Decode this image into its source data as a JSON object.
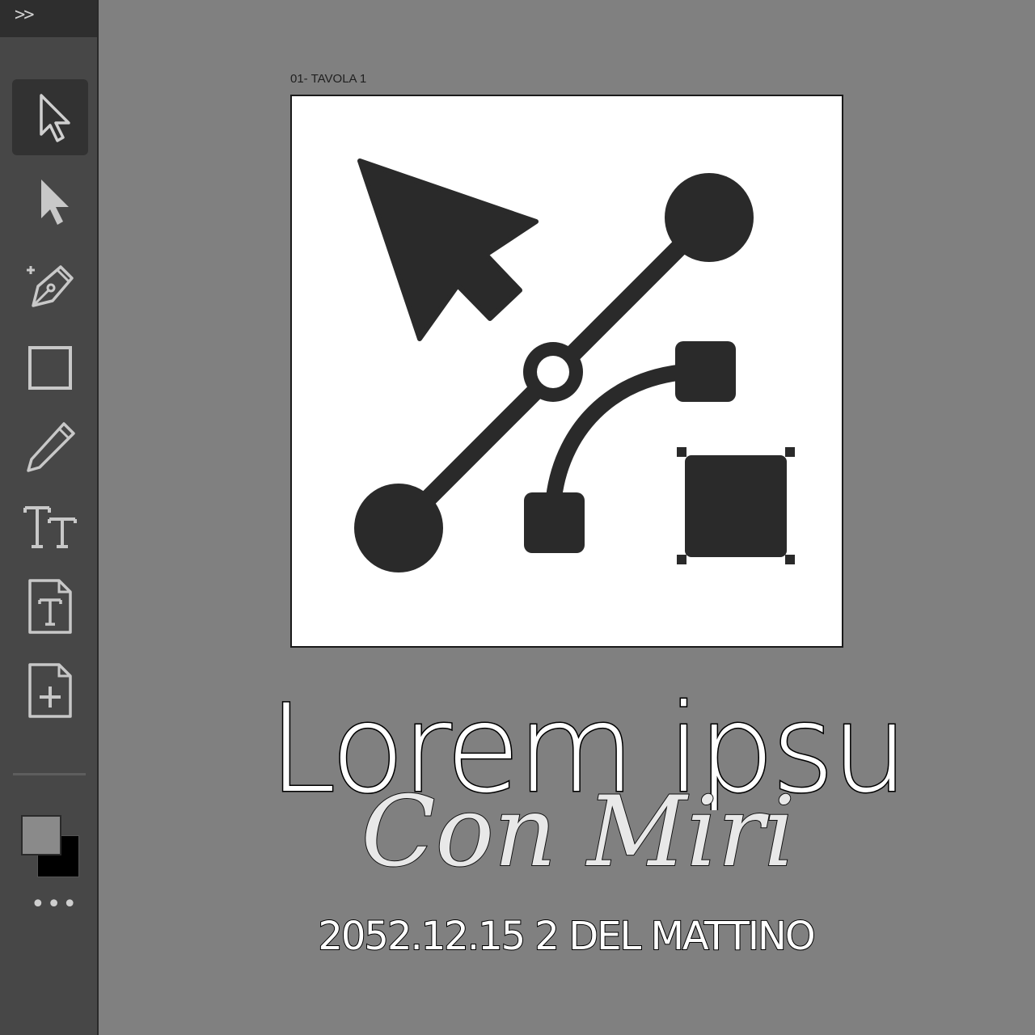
{
  "toolbar": {
    "expand_label": ">>",
    "tools": [
      {
        "name": "selection-tool",
        "icon": "arrow-outline-icon",
        "active": true
      },
      {
        "name": "direct-selection-tool",
        "icon": "arrow-filled-icon",
        "active": false
      },
      {
        "name": "pen-tool",
        "icon": "pen-plus-icon",
        "active": false
      },
      {
        "name": "rectangle-tool",
        "icon": "rectangle-icon",
        "active": false
      },
      {
        "name": "pencil-tool",
        "icon": "pencil-icon",
        "active": false
      },
      {
        "name": "type-tool",
        "icon": "type-tt-icon",
        "active": false
      },
      {
        "name": "text-file-tool",
        "icon": "text-document-icon",
        "active": false
      },
      {
        "name": "add-document-tool",
        "icon": "add-document-icon",
        "active": false
      }
    ],
    "more_label": "•••",
    "fill_color": "#8a8a8a",
    "stroke_color": "#000000"
  },
  "artboard": {
    "label": "01- TAVOLA 1"
  },
  "overlay": {
    "title": "Lorem ipsu",
    "script": "Con Miri",
    "date": "2052.12.15 2 DEL MATTINO"
  }
}
